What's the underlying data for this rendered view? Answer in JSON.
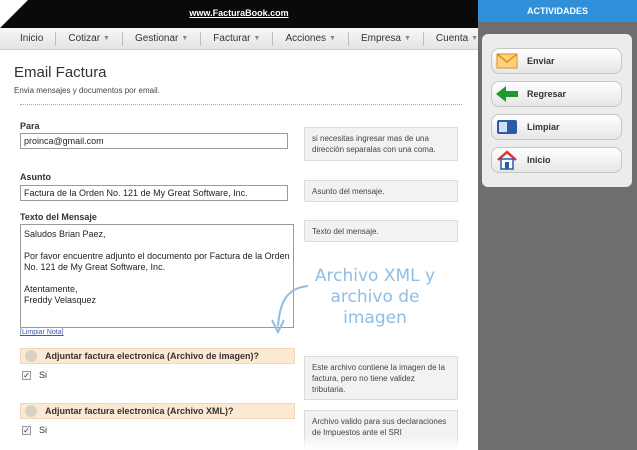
{
  "topbar": {
    "brand": "www.FacturaBook.com"
  },
  "nav": {
    "items": [
      {
        "label": "Inicio",
        "caret": ""
      },
      {
        "label": "Cotizar",
        "caret": "▼"
      },
      {
        "label": "Gestionar",
        "caret": "▼"
      },
      {
        "label": "Facturar",
        "caret": "▼"
      },
      {
        "label": "Acciones",
        "caret": "▼"
      },
      {
        "label": "Empresa",
        "caret": "▼"
      },
      {
        "label": "Cuenta",
        "caret": "▼"
      }
    ]
  },
  "header": {
    "title": "Email Factura",
    "subtitle": "Envia mensajes y documentos por email."
  },
  "form": {
    "to": {
      "label": "Para",
      "value": "proinca@gmail.com",
      "help": "si necesitas ingresar mas de una direcciòn separalas con una coma."
    },
    "subject": {
      "label": "Asunto",
      "value": "Factura de la Orden No. 121 de My Great Software, Inc.",
      "help": "Asunto del mensaje."
    },
    "message": {
      "label": "Texto del Mensaje",
      "value": "Saludos Brian Paez,\n\nPor favor encuentre adjunto el documento por Factura de la Orden No. 121 de My Great Software, Inc.\n\nAtentamente,\nFreddy Velasquez",
      "help": "Texto del mensaje.",
      "clear_note": "[Limpiar Nota]"
    },
    "attach_image": {
      "label": "Adjuntar factura electronica (Archivo de imagen)?",
      "checked": true,
      "option": "Si",
      "help": "Este archivo contiene la imagen de la factura, pero no tiene validez tributaria."
    },
    "attach_xml": {
      "label": "Adjuntar factura electronica (Archivo XML)?",
      "checked": true,
      "option": "Si",
      "help": "Archivo valido para sus declaraciones de Impuestos ante el SRI"
    }
  },
  "annotation": {
    "text": "Archivo XML y archivo de imagen"
  },
  "panel": {
    "title": "ACTIVIDADES",
    "buttons": [
      {
        "label": "Enviar",
        "icon": "envelope-icon"
      },
      {
        "label": "Regresar",
        "icon": "back-arrow-icon"
      },
      {
        "label": "Limpiar",
        "icon": "clear-icon"
      },
      {
        "label": "Inicio",
        "icon": "home-icon"
      }
    ]
  },
  "colors": {
    "panel_header": "#2f8fd9",
    "panel_bg": "#6e6e6e",
    "section_bg": "#fbe9d2",
    "annotation": "#8fbde4"
  }
}
